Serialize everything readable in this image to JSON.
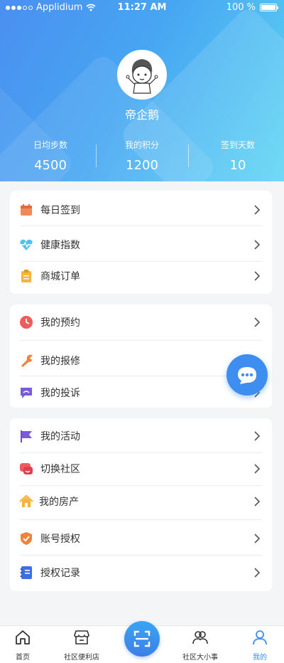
{
  "status_bar": {
    "carrier": "Applidium",
    "time": "11:27 AM",
    "battery": "100 %"
  },
  "profile": {
    "name": "帝企鹅"
  },
  "stats": [
    {
      "label": "日均步数",
      "value": "4500"
    },
    {
      "label": "我的积分",
      "value": "1200"
    },
    {
      "label": "签到天数",
      "value": "10"
    }
  ],
  "cards": [
    {
      "items": [
        {
          "label": "每日签到",
          "icon": "calendar-icon"
        },
        {
          "label": "健康指数",
          "icon": "heart-pulse-icon"
        },
        {
          "label": "商城订单",
          "icon": "clipboard-icon"
        }
      ]
    },
    {
      "items": [
        {
          "label": "我的预约",
          "icon": "clock-icon"
        },
        {
          "label": "我的报修",
          "icon": "wrench-icon"
        },
        {
          "label": "我的投诉",
          "icon": "complaint-icon"
        }
      ]
    },
    {
      "items": [
        {
          "label": "我的活动",
          "icon": "flag-icon"
        },
        {
          "label": "切换社区",
          "icon": "switch-community-icon"
        },
        {
          "label": "我的房产",
          "icon": "house-icon"
        },
        {
          "label": "账号授权",
          "icon": "shield-check-icon"
        },
        {
          "label": "授权记录",
          "icon": "list-icon"
        }
      ]
    }
  ],
  "tabbar": [
    {
      "label": "首页",
      "icon": "home-icon",
      "active": false
    },
    {
      "label": "社区便利店",
      "icon": "store-icon",
      "active": false
    },
    {
      "label": "",
      "icon": "scan-icon",
      "active": false
    },
    {
      "label": "社区大小事",
      "icon": "community-icon",
      "active": false
    },
    {
      "label": "我的",
      "icon": "person-icon",
      "active": true
    }
  ],
  "colors": {
    "accent": "#3d8ef0",
    "header_start": "#4a8ff0",
    "header_end": "#5dd6f4"
  }
}
